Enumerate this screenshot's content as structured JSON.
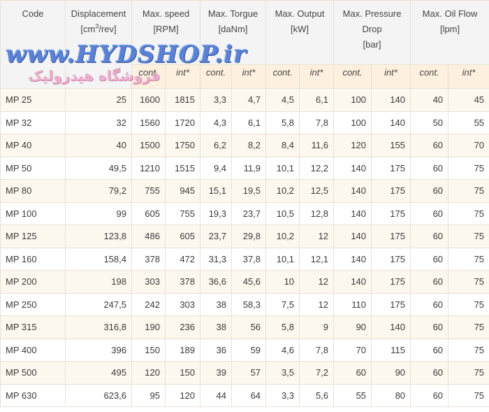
{
  "watermark": {
    "url": "www.HYDSHOP.ir",
    "subtitle": "فروشگاه هیدرولیک"
  },
  "headers": {
    "code": "Code",
    "displacement": "Displacement",
    "displacement_unit_prefix": "[cm",
    "displacement_unit_sup": "3",
    "displacement_unit_suffix": "/rev]",
    "speed": "Max. speed",
    "speed_unit": "[RPM]",
    "torque": "Max. Torgue",
    "torque_unit": "[daNm]",
    "output": "Max. Output",
    "output_unit": "[kW]",
    "pressure": "Max. Pressure Drop",
    "pressure_unit": "[bar]",
    "flow": "Max. Oil Flow",
    "flow_unit": "[lpm]"
  },
  "subheaders": [
    "cont.",
    "int*",
    "cont.",
    "int*",
    "cont.",
    "int*",
    "cont.",
    "int*",
    "cont.",
    "int*"
  ],
  "rows": [
    [
      "MP 25",
      "25",
      "1600",
      "1815",
      "3,3",
      "4,7",
      "4,5",
      "6,1",
      "100",
      "140",
      "40",
      "45"
    ],
    [
      "MP 32",
      "32",
      "1560",
      "1720",
      "4,3",
      "6,1",
      "5,8",
      "7,8",
      "100",
      "140",
      "50",
      "55"
    ],
    [
      "MP 40",
      "40",
      "1500",
      "1750",
      "6,2",
      "8,2",
      "8,4",
      "11,6",
      "120",
      "155",
      "60",
      "70"
    ],
    [
      "MP 50",
      "49,5",
      "1210",
      "1515",
      "9,4",
      "11,9",
      "10,1",
      "12,2",
      "140",
      "175",
      "60",
      "75"
    ],
    [
      "MP 80",
      "79,2",
      "755",
      "945",
      "15,1",
      "19,5",
      "10,2",
      "12,5",
      "140",
      "175",
      "60",
      "75"
    ],
    [
      "MP 100",
      "99",
      "605",
      "755",
      "19,3",
      "23,7",
      "10,5",
      "12,8",
      "140",
      "175",
      "60",
      "75"
    ],
    [
      "MP 125",
      "123,8",
      "486",
      "605",
      "23,7",
      "29,8",
      "10,2",
      "12",
      "140",
      "175",
      "60",
      "75"
    ],
    [
      "MP 160",
      "158,4",
      "378",
      "472",
      "31,3",
      "37,8",
      "10,1",
      "12,1",
      "140",
      "175",
      "60",
      "75"
    ],
    [
      "MP 200",
      "198",
      "303",
      "378",
      "36,6",
      "45,6",
      "10",
      "12",
      "140",
      "175",
      "60",
      "75"
    ],
    [
      "MP 250",
      "247,5",
      "242",
      "303",
      "38",
      "58,3",
      "7,5",
      "12",
      "110",
      "175",
      "60",
      "75"
    ],
    [
      "MP 315",
      "316,8",
      "190",
      "236",
      "38",
      "56",
      "5,8",
      "9",
      "90",
      "140",
      "60",
      "75"
    ],
    [
      "MP 400",
      "396",
      "150",
      "189",
      "36",
      "59",
      "4,6",
      "7,8",
      "70",
      "115",
      "60",
      "75"
    ],
    [
      "MP 500",
      "495",
      "120",
      "150",
      "39",
      "57",
      "3,5",
      "7,2",
      "60",
      "90",
      "60",
      "75"
    ],
    [
      "MP 630",
      "623,6",
      "95",
      "120",
      "44",
      "64",
      "3,3",
      "5,6",
      "55",
      "80",
      "60",
      "75"
    ]
  ]
}
